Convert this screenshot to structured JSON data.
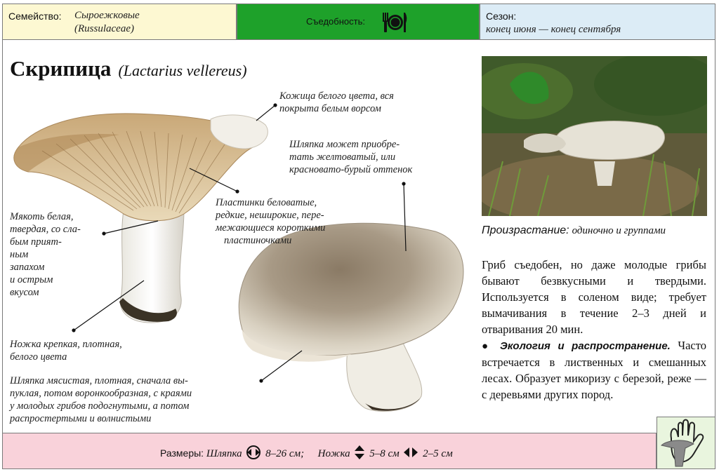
{
  "header": {
    "family_label": "Семейство:",
    "family_value": "Сыроежковые",
    "family_latin": "(Russulaceae)",
    "edibility_label": "Съедобность:",
    "edibility_icon": "plate-fork-knife-icon",
    "season_label": "Сезон:",
    "season_value": "конец июня — конец сентября"
  },
  "title": {
    "name": "Скрипица",
    "latin": "(Lactarius vellereus)"
  },
  "annotations": {
    "skin": [
      "Кожица белого цвета, вся",
      "покрыта белым ворсом"
    ],
    "cap_color": [
      "Шляпка может приобре-",
      "тать желтоватый, или",
      "красновато-бурый оттенок"
    ],
    "gills": [
      "Пластинки беловатые,",
      "редкие, неширокие, пере-",
      "межающиеся короткими",
      "пластиночками"
    ],
    "flesh": [
      "Мякоть белая,",
      "твердая, со сла-",
      "бым прият-",
      "ным",
      "запахом",
      "и острым",
      "вкусом"
    ],
    "stem": [
      "Ножка крепкая, плотная,",
      "белого цвета"
    ],
    "cap": [
      "Шляпка мясистая, плотная, сначала вы-",
      "пуклая, потом воронкообразная, с краями",
      "у молодых грибов подогнутыми, а потом",
      "распростертыми и волнистыми"
    ]
  },
  "habitat": {
    "label": "Произрастание:",
    "value": "одиночно и группами"
  },
  "description": {
    "text": "Гриб съедобен, но даже молодые грибы бывают безвкусными и твердыми. Используется в соленом виде; требует вымачивания в течение 2–3 дней и отваривания 20 мин.",
    "ecology_heading": "● Экология и распространение.",
    "ecology_text": "Часто встречается в лиственных и смешанных лесах. Образует микоризу с березой, реже — с деревьями других пород."
  },
  "sizes": {
    "label": "Размеры:",
    "cap_label": "Шляпка",
    "cap_value": "8–26 см;",
    "stem_label": "Ножка",
    "stem_length": "5–8 см",
    "stem_width": "2–5 см"
  },
  "colors": {
    "family_bg": "#fdf8d2",
    "edibility_bg": "#1ea12a",
    "season_bg": "#dcecf6",
    "footer_bg": "#f9d2da",
    "hand_bg": "#e9f5de"
  }
}
